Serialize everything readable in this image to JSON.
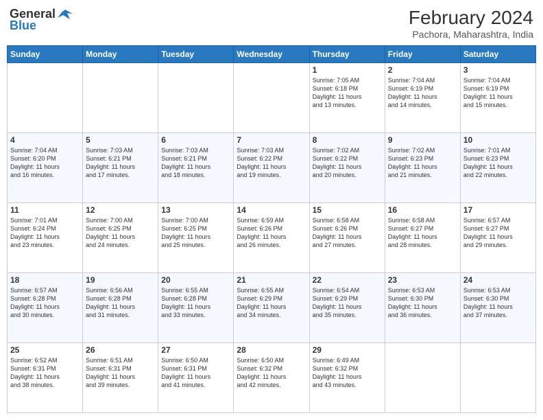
{
  "header": {
    "logo_general": "General",
    "logo_blue": "Blue",
    "month_year": "February 2024",
    "location": "Pachora, Maharashtra, India"
  },
  "days_of_week": [
    "Sunday",
    "Monday",
    "Tuesday",
    "Wednesday",
    "Thursday",
    "Friday",
    "Saturday"
  ],
  "weeks": [
    [
      {
        "day": "",
        "info": ""
      },
      {
        "day": "",
        "info": ""
      },
      {
        "day": "",
        "info": ""
      },
      {
        "day": "",
        "info": ""
      },
      {
        "day": "1",
        "info": "Sunrise: 7:05 AM\nSunset: 6:18 PM\nDaylight: 11 hours\nand 13 minutes."
      },
      {
        "day": "2",
        "info": "Sunrise: 7:04 AM\nSunset: 6:19 PM\nDaylight: 11 hours\nand 14 minutes."
      },
      {
        "day": "3",
        "info": "Sunrise: 7:04 AM\nSunset: 6:19 PM\nDaylight: 11 hours\nand 15 minutes."
      }
    ],
    [
      {
        "day": "4",
        "info": "Sunrise: 7:04 AM\nSunset: 6:20 PM\nDaylight: 11 hours\nand 16 minutes."
      },
      {
        "day": "5",
        "info": "Sunrise: 7:03 AM\nSunset: 6:21 PM\nDaylight: 11 hours\nand 17 minutes."
      },
      {
        "day": "6",
        "info": "Sunrise: 7:03 AM\nSunset: 6:21 PM\nDaylight: 11 hours\nand 18 minutes."
      },
      {
        "day": "7",
        "info": "Sunrise: 7:03 AM\nSunset: 6:22 PM\nDaylight: 11 hours\nand 19 minutes."
      },
      {
        "day": "8",
        "info": "Sunrise: 7:02 AM\nSunset: 6:22 PM\nDaylight: 11 hours\nand 20 minutes."
      },
      {
        "day": "9",
        "info": "Sunrise: 7:02 AM\nSunset: 6:23 PM\nDaylight: 11 hours\nand 21 minutes."
      },
      {
        "day": "10",
        "info": "Sunrise: 7:01 AM\nSunset: 6:23 PM\nDaylight: 11 hours\nand 22 minutes."
      }
    ],
    [
      {
        "day": "11",
        "info": "Sunrise: 7:01 AM\nSunset: 6:24 PM\nDaylight: 11 hours\nand 23 minutes."
      },
      {
        "day": "12",
        "info": "Sunrise: 7:00 AM\nSunset: 6:25 PM\nDaylight: 11 hours\nand 24 minutes."
      },
      {
        "day": "13",
        "info": "Sunrise: 7:00 AM\nSunset: 6:25 PM\nDaylight: 11 hours\nand 25 minutes."
      },
      {
        "day": "14",
        "info": "Sunrise: 6:59 AM\nSunset: 6:26 PM\nDaylight: 11 hours\nand 26 minutes."
      },
      {
        "day": "15",
        "info": "Sunrise: 6:58 AM\nSunset: 6:26 PM\nDaylight: 11 hours\nand 27 minutes."
      },
      {
        "day": "16",
        "info": "Sunrise: 6:58 AM\nSunset: 6:27 PM\nDaylight: 11 hours\nand 28 minutes."
      },
      {
        "day": "17",
        "info": "Sunrise: 6:57 AM\nSunset: 6:27 PM\nDaylight: 11 hours\nand 29 minutes."
      }
    ],
    [
      {
        "day": "18",
        "info": "Sunrise: 6:57 AM\nSunset: 6:28 PM\nDaylight: 11 hours\nand 30 minutes."
      },
      {
        "day": "19",
        "info": "Sunrise: 6:56 AM\nSunset: 6:28 PM\nDaylight: 11 hours\nand 31 minutes."
      },
      {
        "day": "20",
        "info": "Sunrise: 6:55 AM\nSunset: 6:28 PM\nDaylight: 11 hours\nand 33 minutes."
      },
      {
        "day": "21",
        "info": "Sunrise: 6:55 AM\nSunset: 6:29 PM\nDaylight: 11 hours\nand 34 minutes."
      },
      {
        "day": "22",
        "info": "Sunrise: 6:54 AM\nSunset: 6:29 PM\nDaylight: 11 hours\nand 35 minutes."
      },
      {
        "day": "23",
        "info": "Sunrise: 6:53 AM\nSunset: 6:30 PM\nDaylight: 11 hours\nand 36 minutes."
      },
      {
        "day": "24",
        "info": "Sunrise: 6:53 AM\nSunset: 6:30 PM\nDaylight: 11 hours\nand 37 minutes."
      }
    ],
    [
      {
        "day": "25",
        "info": "Sunrise: 6:52 AM\nSunset: 6:31 PM\nDaylight: 11 hours\nand 38 minutes."
      },
      {
        "day": "26",
        "info": "Sunrise: 6:51 AM\nSunset: 6:31 PM\nDaylight: 11 hours\nand 39 minutes."
      },
      {
        "day": "27",
        "info": "Sunrise: 6:50 AM\nSunset: 6:31 PM\nDaylight: 11 hours\nand 41 minutes."
      },
      {
        "day": "28",
        "info": "Sunrise: 6:50 AM\nSunset: 6:32 PM\nDaylight: 11 hours\nand 42 minutes."
      },
      {
        "day": "29",
        "info": "Sunrise: 6:49 AM\nSunset: 6:32 PM\nDaylight: 11 hours\nand 43 minutes."
      },
      {
        "day": "",
        "info": ""
      },
      {
        "day": "",
        "info": ""
      }
    ]
  ]
}
